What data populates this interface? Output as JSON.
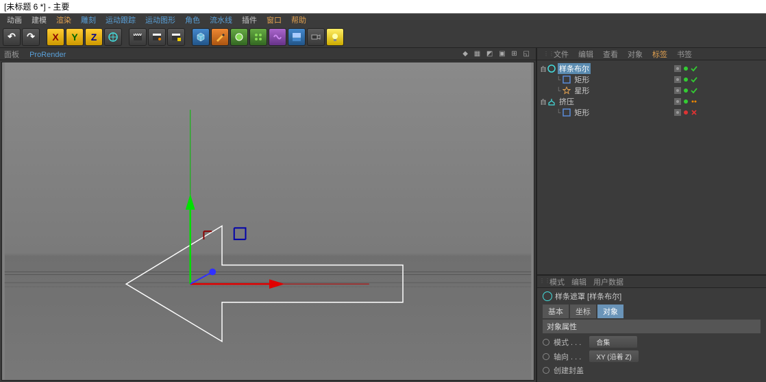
{
  "titlebar": "[未标题 6 *] - 主要",
  "menu": [
    "动画",
    "建模",
    "渲染",
    "雕刻",
    "运动跟踪",
    "运动图形",
    "角色",
    "流水线",
    "插件",
    "窗口",
    "帮助"
  ],
  "menu_hl_blue": [
    3,
    4,
    5,
    6,
    7
  ],
  "menu_hl_orange": [
    2,
    9,
    10
  ],
  "toolbar_axes": {
    "x": "X",
    "y": "Y",
    "z": "Z"
  },
  "viewport_tabs": {
    "panel": "面板",
    "pro": "ProRender"
  },
  "obj_panel_tabs": [
    "文件",
    "编辑",
    "查看",
    "对象",
    "标签",
    "书签"
  ],
  "obj_panel_active_idx": 4,
  "tree": {
    "items": [
      {
        "name": "样条布尔",
        "sel": true,
        "icon": "circle",
        "color": "#4dd",
        "exp": "白",
        "depth": 0,
        "tags": [
          "grey",
          "green",
          "check"
        ]
      },
      {
        "name": "矩形",
        "icon": "square",
        "color": "#5a8bd8",
        "depth": 1,
        "tags": [
          "grey",
          "green",
          "check"
        ]
      },
      {
        "name": "星形",
        "icon": "star",
        "color": "#e0a050",
        "depth": 1,
        "tags": [
          "grey",
          "green",
          "check"
        ]
      },
      {
        "name": "挤压",
        "icon": "extrude",
        "color": "#4dd",
        "exp": "白",
        "depth": 0,
        "tags": [
          "grey",
          "green",
          "dots"
        ]
      },
      {
        "name": "矩形",
        "icon": "square",
        "color": "#5a8bd8",
        "depth": 1,
        "tags": [
          "grey",
          "red",
          "x"
        ]
      }
    ]
  },
  "attr_tabs": [
    "模式",
    "编辑",
    "用户数据"
  ],
  "attr_title": "样条遮罩 [样条布尔]",
  "subtabs": [
    "基本",
    "坐标",
    "对象"
  ],
  "subtabs_active_idx": 2,
  "section": "对象属性",
  "props": [
    {
      "label": "模式 . . .",
      "value": "合集"
    },
    {
      "label": "轴向 . . .",
      "value": "XY (沿着 Z)"
    },
    {
      "label": "创建封盖"
    }
  ]
}
